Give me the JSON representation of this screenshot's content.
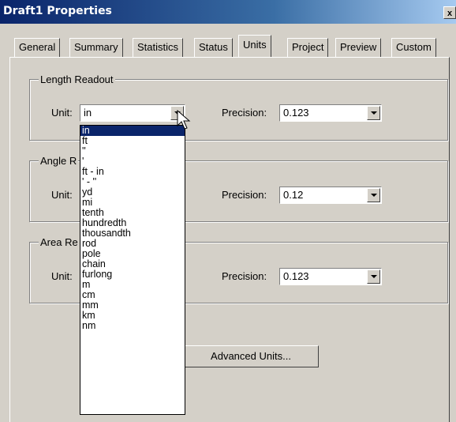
{
  "window": {
    "title": "Draft1 Properties",
    "close_label": "x"
  },
  "tabs": [
    {
      "label": "General"
    },
    {
      "label": "Summary"
    },
    {
      "label": "Statistics"
    },
    {
      "label": "Status"
    },
    {
      "label": "Units"
    },
    {
      "label": "Project"
    },
    {
      "label": "Preview"
    },
    {
      "label": "Custom"
    }
  ],
  "active_tab": "Units",
  "length_group": {
    "label": "Length Readout",
    "unit_label": "Unit:",
    "unit_value": "in",
    "precision_label": "Precision:",
    "precision_value": "0.123"
  },
  "angle_group": {
    "label_visible": "Angle R",
    "unit_label": "Unit:",
    "precision_label": "Precision:",
    "precision_value": "0.12"
  },
  "area_group": {
    "label_visible": "Area Re",
    "unit_label": "Unit:",
    "precision_label": "Precision:",
    "precision_value": "0.123"
  },
  "advanced_button": {
    "label": "Advanced Units..."
  },
  "unit_dropdown": {
    "options": [
      "in",
      "ft",
      "''",
      "'",
      "ft - in",
      "' - ''",
      "yd",
      "mi",
      "tenth",
      "hundredth",
      "thousandth",
      "rod",
      "pole",
      "chain",
      "furlong",
      "m",
      "cm",
      "mm",
      "km",
      "nm"
    ],
    "highlighted": "in"
  },
  "colors": {
    "titlebar": "#0a246a",
    "face": "#d4d0c8",
    "highlight": "#0a246a"
  }
}
